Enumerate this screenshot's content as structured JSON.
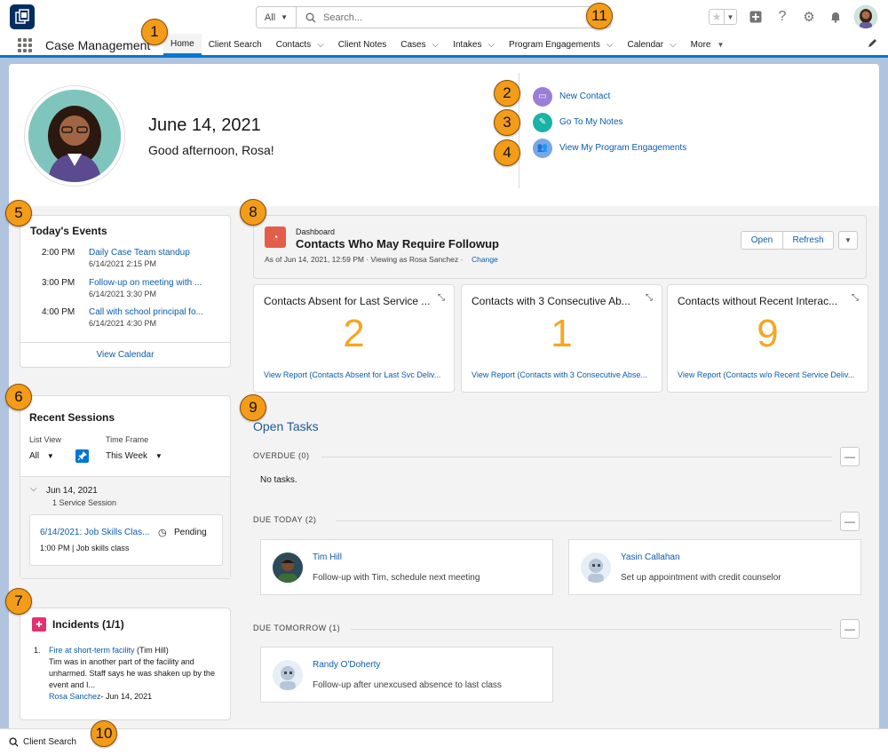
{
  "header": {
    "search_scope": "All",
    "search_placeholder": "Search..."
  },
  "nav": {
    "app_name": "Case Management",
    "items": [
      {
        "label": "Home",
        "has_menu": false,
        "active": true
      },
      {
        "label": "Client Search",
        "has_menu": false
      },
      {
        "label": "Contacts",
        "has_menu": true
      },
      {
        "label": "Client Notes",
        "has_menu": false
      },
      {
        "label": "Cases",
        "has_menu": true
      },
      {
        "label": "Intakes",
        "has_menu": true
      },
      {
        "label": "Program Engagements",
        "has_menu": true
      },
      {
        "label": "Calendar",
        "has_menu": true
      },
      {
        "label": "More",
        "has_menu": true
      }
    ]
  },
  "hero": {
    "date": "June 14, 2021",
    "greeting": "Good afternoon, Rosa!",
    "quick_actions": [
      {
        "label": "New Contact",
        "color": "#9b7ed9"
      },
      {
        "label": "Go To My Notes",
        "color": "#1ab3a6"
      },
      {
        "label": "View My Program Engagements",
        "color": "#7aa6e8"
      }
    ]
  },
  "events": {
    "title": "Today's Events",
    "items": [
      {
        "time": "2:00 PM",
        "title": "Daily Case Team standup",
        "sub": "6/14/2021 2:15 PM"
      },
      {
        "time": "3:00 PM",
        "title": "Follow-up on meeting with ...",
        "sub": "6/14/2021 3:30 PM"
      },
      {
        "time": "4:00 PM",
        "title": "Call with school principal fo...",
        "sub": "6/14/2021 4:30 PM"
      }
    ],
    "footer": "View Calendar"
  },
  "sessions": {
    "title": "Recent Sessions",
    "list_view_label": "List View",
    "list_view_value": "All",
    "time_frame_label": "Time Frame",
    "time_frame_value": "This Week",
    "group_date": "Jun 14, 2021",
    "group_count": "1 Service Session",
    "item_title": "6/14/2021: Job Skills Clas...",
    "item_status": "Pending",
    "item_detail": "1:00 PM | Job skills class"
  },
  "incidents": {
    "title": "Incidents (1/1)",
    "number": "1.",
    "link": "Fire at short-term facility",
    "who": "(Tim Hill)",
    "body": "Tim was in another part of the facility and unharmed. Staff says he was shaken up by the event and I...",
    "author": "Rosa Sanchez",
    "date": "- Jun 14, 2021"
  },
  "dashboard": {
    "kicker": "Dashboard",
    "title": "Contacts Who May Require Followup",
    "as_of": "As of Jun 14, 2021, 12:59 PM · Viewing as Rosa Sanchez ·",
    "change": "Change",
    "open": "Open",
    "refresh": "Refresh",
    "metrics": [
      {
        "title": "Contacts Absent for Last Service ...",
        "value": "2",
        "report": "View Report (Contacts Absent for Last Svc Deliv..."
      },
      {
        "title": "Contacts with 3 Consecutive Ab...",
        "value": "1",
        "report": "View Report (Contacts with 3 Consecutive Abse..."
      },
      {
        "title": "Contacts without Recent Interac...",
        "value": "9",
        "report": "View Report (Contacts w/o Recent Service Deliv..."
      }
    ]
  },
  "tasks": {
    "title": "Open Tasks",
    "overdue_label": "OVERDUE (0)",
    "overdue_empty": "No tasks.",
    "today_label": "DUE TODAY (2)",
    "today": [
      {
        "name": "Tim Hill",
        "desc": "Follow-up with Tim, schedule next meeting"
      },
      {
        "name": "Yasin Callahan",
        "desc": "Set up appointment with credit counselor"
      }
    ],
    "tomorrow_label": "DUE TOMORROW (1)",
    "tomorrow": [
      {
        "name": "Randy O'Doherty",
        "desc": "Follow-up after unexcused absence to last class"
      }
    ]
  },
  "utility_bar": {
    "label": "Client Search"
  },
  "callouts": [
    "1",
    "2",
    "3",
    "4",
    "5",
    "6",
    "7",
    "8",
    "9",
    "10",
    "11"
  ],
  "colors": {
    "brand": "#0176d3",
    "link": "#0b5cab",
    "metric": "#f5a623",
    "callout": "#f39c1a"
  }
}
